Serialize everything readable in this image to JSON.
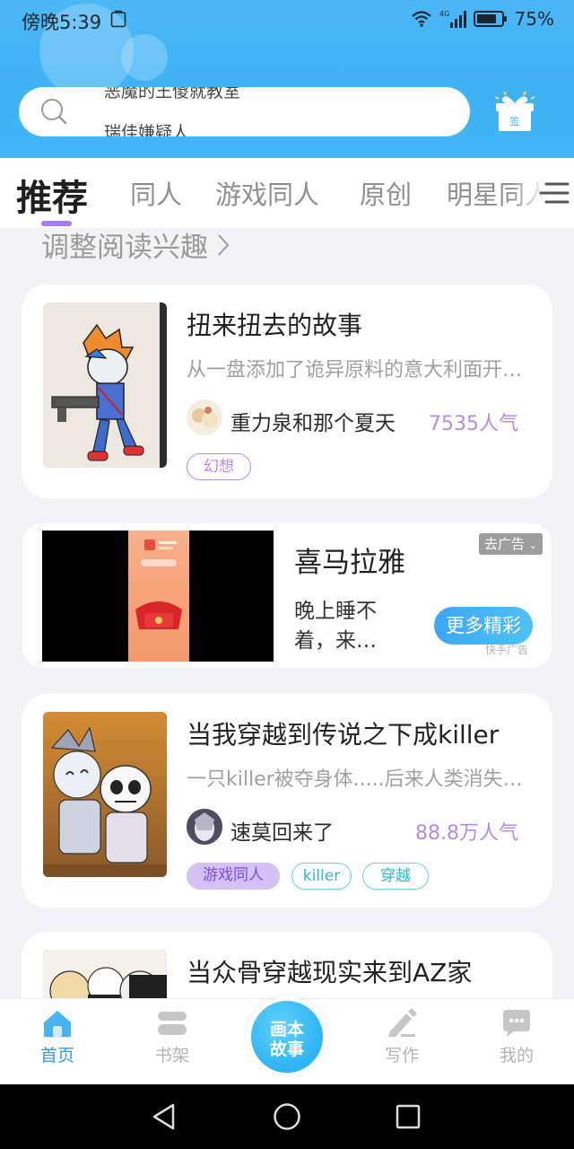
{
  "status_bar": {
    "time": "傍晚5:39",
    "network": "4G",
    "battery": "75%"
  },
  "search": {
    "hint_top": "恶魔的王傻就教室",
    "hint_bottom": "瑞佳嫌疑人"
  },
  "tabs": [
    {
      "label": "推荐",
      "active": true
    },
    {
      "label": "同人"
    },
    {
      "label": "游戏同人"
    },
    {
      "label": "原创"
    },
    {
      "label": "明星同人"
    }
  ],
  "interest_link": "调整阅读兴趣",
  "stories": [
    {
      "title": "扭来扭去的故事",
      "desc": "从一盘添加了诡异原料的意大利面开始的故事",
      "author": "重力泉和那个夏天",
      "popularity": "7535人气",
      "tags": [
        "幻想"
      ]
    },
    {
      "title": "当我穿越到传说之下成killer",
      "desc": "一只killer被夺身体.....后来人类消失了的故事",
      "author": "速莫回来了",
      "popularity": "88.8万人气",
      "tags": [
        "游戏同人",
        "killer",
        "穿越"
      ]
    },
    {
      "title": "当众骨穿越现实来到AZ家"
    }
  ],
  "ad": {
    "title": "喜马拉雅",
    "desc": "晚上睡不着，来…",
    "close_label": "去广告",
    "cta": "更多精彩",
    "source": "快手广告"
  },
  "bottom_nav": {
    "home": "首页",
    "shelf": "书架",
    "center_line1": "画本",
    "center_line2": "故事",
    "write": "写作",
    "mine": "我的"
  },
  "colors": {
    "brand_blue": "#3fb2f5",
    "accent_purple": "#b58be8",
    "tag_cyan": "#33b7c8"
  }
}
